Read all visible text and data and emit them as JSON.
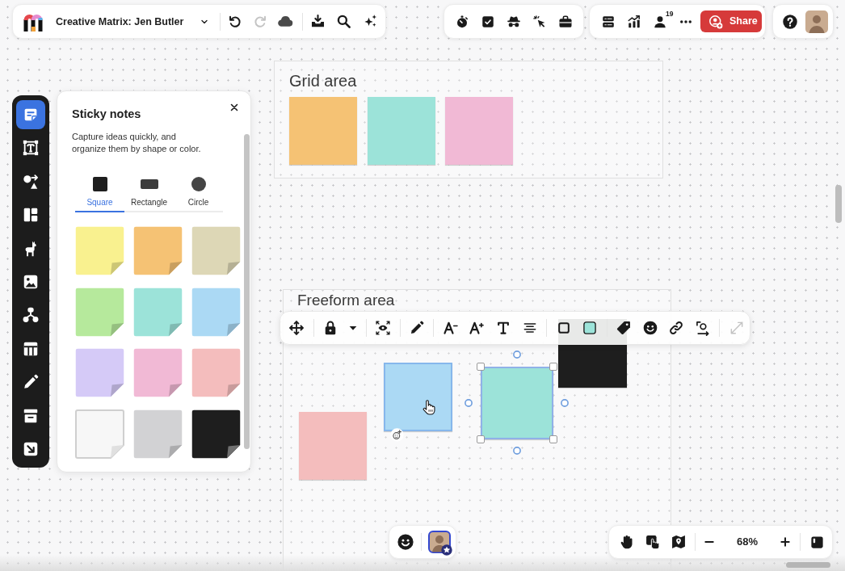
{
  "top_bar": {
    "board_title": "Creative Matrix: Jen Butler",
    "redo_disabled": true,
    "collaborator_count": "19",
    "share_label": "Share"
  },
  "tool_rail": {
    "items": [
      {
        "selected": true
      },
      {
        "selected": false
      },
      {
        "selected": false
      },
      {
        "selected": false
      },
      {
        "selected": false
      },
      {
        "selected": false
      },
      {
        "selected": false
      },
      {
        "selected": false
      },
      {
        "selected": false
      },
      {
        "selected": false
      },
      {
        "selected": false
      }
    ]
  },
  "sticky_notes_panel": {
    "title": "Sticky notes",
    "description": "Capture ideas quickly, and organize them by shape or color.",
    "shapes": [
      {
        "label": "Square",
        "selected": true
      },
      {
        "label": "Rectangle",
        "selected": false
      },
      {
        "label": "Circle",
        "selected": false
      }
    ],
    "swatches": [
      {
        "color": "#f9f18f"
      },
      {
        "color": "#f5c274"
      },
      {
        "color": "#ddd7b6"
      },
      {
        "color": "#b6e99c"
      },
      {
        "color": "#9ce3d9"
      },
      {
        "color": "#abd9f4"
      },
      {
        "color": "#d5caf7"
      },
      {
        "color": "#f1b9d5"
      },
      {
        "color": "#f4bdbd"
      },
      {
        "color": "#f7f7f7"
      },
      {
        "color": "#d2d2d4"
      },
      {
        "color": "#1e1e1e"
      }
    ]
  },
  "canvas": {
    "frames": [
      {
        "kind": "grid",
        "title": "Grid area",
        "notes": [
          {
            "color": "#f5c274"
          },
          {
            "color": "#9ce3d9"
          },
          {
            "color": "#f1b9d5"
          }
        ]
      },
      {
        "kind": "freeform",
        "title": "Freeform area",
        "notes": [
          {
            "color": "#f4bdbd",
            "selected": false,
            "hovered": false
          },
          {
            "color": "#abd9f4",
            "selected": false,
            "hovered": true
          },
          {
            "color": "#9ce3d9",
            "selected": true,
            "hovered": false
          },
          {
            "color": "#1e1e1e",
            "selected": false,
            "hovered": false
          }
        ]
      }
    ]
  },
  "floating_toolbar": {
    "expand_disabled": true
  },
  "zoom_controls": {
    "zoom_level": "68%"
  }
}
